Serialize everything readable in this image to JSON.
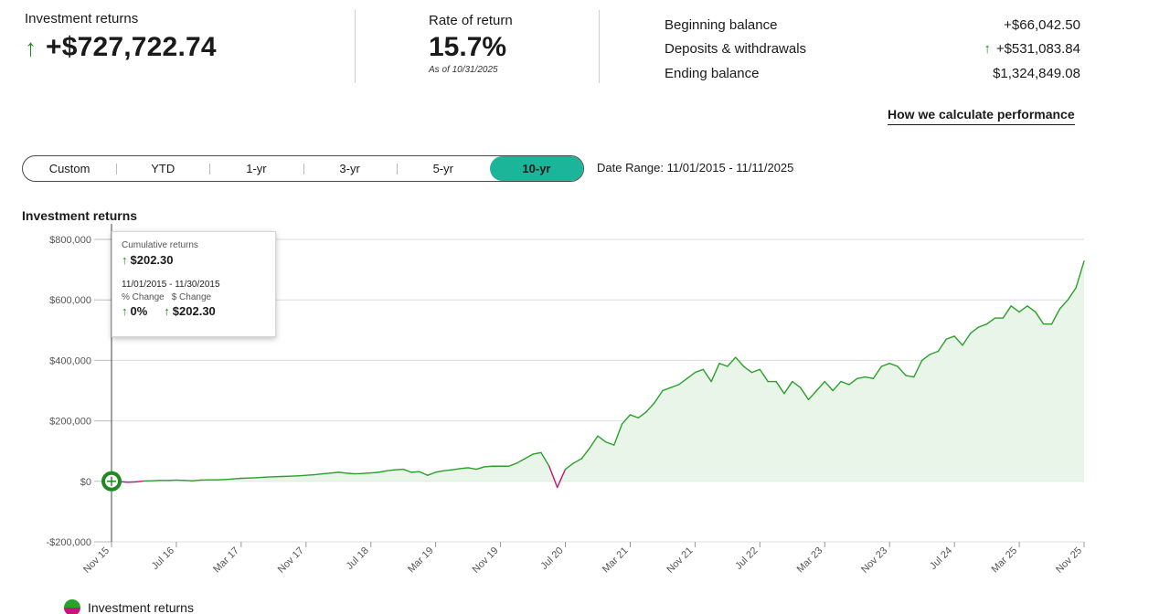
{
  "summary": {
    "returns_label": "Investment returns",
    "returns_arrow": "↑",
    "returns_value": "+$727,722.74",
    "rate_label": "Rate of return",
    "rate_value": "15.7%",
    "rate_asof": "As of 10/31/2025",
    "balances": [
      {
        "label": "Beginning balance",
        "arrow": "",
        "value": "+$66,042.50"
      },
      {
        "label": "Deposits & withdrawals",
        "arrow": "↑",
        "value": "+$531,083.84"
      },
      {
        "label": "Ending balance",
        "arrow": "",
        "value": "$1,324,849.08"
      }
    ]
  },
  "how_link": "How we calculate performance",
  "ranges": [
    {
      "label": "Custom",
      "active": false
    },
    {
      "label": "YTD",
      "active": false
    },
    {
      "label": "1-yr",
      "active": false
    },
    {
      "label": "3-yr",
      "active": false
    },
    {
      "label": "5-yr",
      "active": false
    },
    {
      "label": "10-yr",
      "active": true
    }
  ],
  "date_range": "Date Range: 11/01/2015 - 11/11/2025",
  "tooltip": {
    "cum_label": "Cumulative returns",
    "cum_value": "$202.30",
    "period": "11/01/2015 - 11/30/2015",
    "pct_label": "% Change",
    "dollar_label": "$ Change",
    "pct_value": "0%",
    "dollar_value": "$202.30",
    "arrow": "↑"
  },
  "legend": {
    "label": "Investment returns"
  },
  "colors": {
    "positive": "#2aa12a",
    "negative": "#c4177a",
    "fill": "#e8f5e8",
    "accent": "#1bb59a",
    "marker": "#1f8a1f"
  },
  "chart_data": {
    "type": "area",
    "title": "Investment returns",
    "ylim": [
      -200000,
      800000
    ],
    "yticks": [
      -200000,
      0,
      200000,
      400000,
      600000,
      800000
    ],
    "ytick_labels": [
      "-$200,000",
      "$0",
      "$200,000",
      "$400,000",
      "$600,000",
      "$800,000"
    ],
    "xtick_labels": [
      "Nov 15",
      "Jul 16",
      "Mar 17",
      "Nov 17",
      "Jul 18",
      "Mar 19",
      "Nov 19",
      "Jul 20",
      "Mar 21",
      "Nov 21",
      "Jul 22",
      "Mar 23",
      "Nov 23",
      "Jul 24",
      "Mar 25",
      "Nov 25"
    ],
    "x_unit": "months since Nov 2015",
    "xtick_positions": [
      0,
      8,
      16,
      24,
      32,
      40,
      48,
      56,
      64,
      72,
      80,
      88,
      96,
      104,
      112,
      120
    ],
    "grid": true,
    "legend_position": "bottom-left",
    "series": [
      {
        "name": "Investment returns",
        "x": [
          0,
          1,
          2,
          3,
          4,
          5,
          6,
          7,
          8,
          9,
          10,
          11,
          12,
          13,
          14,
          15,
          16,
          17,
          18,
          19,
          20,
          21,
          22,
          23,
          24,
          25,
          26,
          27,
          28,
          29,
          30,
          31,
          32,
          33,
          34,
          35,
          36,
          37,
          38,
          39,
          40,
          41,
          42,
          43,
          44,
          45,
          46,
          47,
          48,
          49,
          50,
          51,
          52,
          53,
          54,
          55,
          56,
          57,
          58,
          59,
          60,
          61,
          62,
          63,
          64,
          65,
          66,
          67,
          68,
          69,
          70,
          71,
          72,
          73,
          74,
          75,
          76,
          77,
          78,
          79,
          80,
          81,
          82,
          83,
          84,
          85,
          86,
          87,
          88,
          89,
          90,
          91,
          92,
          93,
          94,
          95,
          96,
          97,
          98,
          99,
          100,
          101,
          102,
          103,
          104,
          105,
          106,
          107,
          108,
          109,
          110,
          111,
          112,
          113,
          114,
          115,
          116,
          117,
          118,
          119,
          120
        ],
        "y": [
          202,
          -1000,
          -3000,
          -2000,
          1000,
          2000,
          3000,
          3000,
          4000,
          3000,
          2000,
          4000,
          5000,
          5000,
          6000,
          8000,
          10000,
          11000,
          12000,
          14000,
          15000,
          16000,
          17000,
          18000,
          20000,
          22000,
          25000,
          27000,
          30000,
          27000,
          25000,
          26000,
          28000,
          30000,
          35000,
          38000,
          40000,
          30000,
          32000,
          20000,
          30000,
          35000,
          38000,
          42000,
          45000,
          40000,
          48000,
          50000,
          50000,
          50000,
          60000,
          75000,
          90000,
          95000,
          50000,
          -20000,
          40000,
          60000,
          75000,
          110000,
          150000,
          130000,
          120000,
          190000,
          220000,
          210000,
          230000,
          260000,
          300000,
          310000,
          320000,
          340000,
          360000,
          370000,
          330000,
          390000,
          380000,
          410000,
          380000,
          360000,
          370000,
          330000,
          330000,
          290000,
          330000,
          310000,
          270000,
          300000,
          330000,
          300000,
          330000,
          320000,
          340000,
          345000,
          340000,
          380000,
          390000,
          380000,
          350000,
          345000,
          400000,
          420000,
          430000,
          470000,
          480000,
          450000,
          490000,
          510000,
          520000,
          540000,
          540000,
          580000,
          560000,
          580000,
          560000,
          520000,
          520000,
          570000,
          600000,
          640000,
          728000
        ]
      }
    ]
  }
}
